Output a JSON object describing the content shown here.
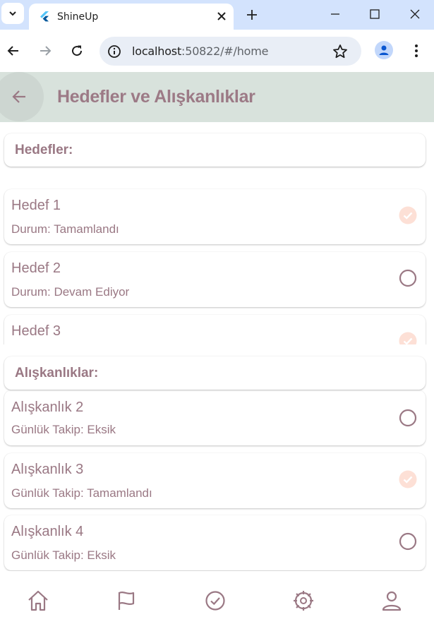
{
  "browser": {
    "tab_title": "ShineUp",
    "url_host": "localhost",
    "url_rest": ":50822/#/home"
  },
  "appbar": {
    "title": "Hedefler ve Alışkanlıklar"
  },
  "goals": {
    "header": "Hedefler:",
    "items": [
      {
        "title": "Hedef 1",
        "status": "Durum: Tamamlandı",
        "done": true
      },
      {
        "title": "Hedef 2",
        "status": "Durum: Devam Ediyor",
        "done": false
      },
      {
        "title": "Hedef 3",
        "status": "",
        "done": true
      }
    ]
  },
  "habits": {
    "header": "Alışkanlıklar:",
    "items": [
      {
        "title": "Alışkanlık 2",
        "status": "Günlük Takip: Eksik",
        "done": false
      },
      {
        "title": "Alışkanlık 3",
        "status": "Günlük Takip: Tamamlandı",
        "done": true
      },
      {
        "title": "Alışkanlık 4",
        "status": "Günlük Takip: Eksik",
        "done": false
      }
    ]
  },
  "bottom_nav": [
    "home-icon",
    "flag-icon",
    "check-circle-icon",
    "settings-gear-icon",
    "profile-icon"
  ],
  "colors": {
    "accent_text": "#9a7884",
    "appbar_bg": "#d8e2dc",
    "done_icon": "#fde0d6",
    "pending_icon": "#9a7884"
  }
}
